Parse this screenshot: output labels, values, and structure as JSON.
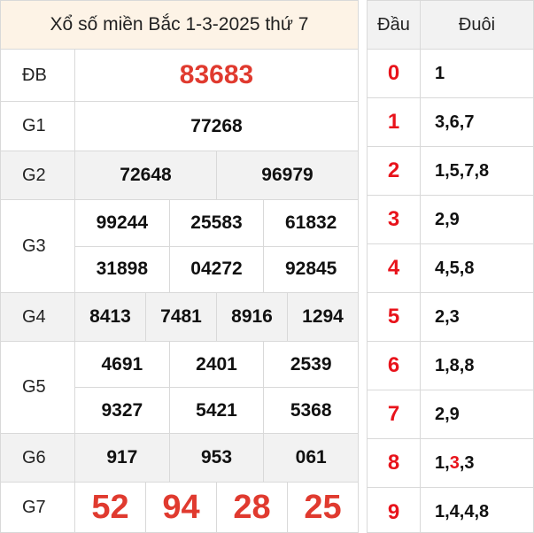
{
  "title": "Xổ số miền Bắc 1-3-2025 thứ 7",
  "prizes": [
    {
      "label": "ĐB",
      "lines": [
        [
          "83683"
        ]
      ]
    },
    {
      "label": "G1",
      "lines": [
        [
          "77268"
        ]
      ]
    },
    {
      "label": "G2",
      "lines": [
        [
          "72648",
          "96979"
        ]
      ]
    },
    {
      "label": "G3",
      "lines": [
        [
          "99244",
          "25583",
          "61832"
        ],
        [
          "31898",
          "04272",
          "92845"
        ]
      ]
    },
    {
      "label": "G4",
      "lines": [
        [
          "8413",
          "7481",
          "8916",
          "1294"
        ]
      ]
    },
    {
      "label": "G5",
      "lines": [
        [
          "4691",
          "2401",
          "2539"
        ],
        [
          "9327",
          "5421",
          "5368"
        ]
      ]
    },
    {
      "label": "G6",
      "lines": [
        [
          "917",
          "953",
          "061"
        ]
      ]
    },
    {
      "label": "G7",
      "lines": [
        [
          "52",
          "94",
          "28",
          "25"
        ]
      ]
    }
  ],
  "loto": {
    "header_dau": "Đầu",
    "header_duoi": "Đuôi",
    "rows": [
      {
        "dau": "0",
        "duoi": "1"
      },
      {
        "dau": "1",
        "duoi": "3,6,7"
      },
      {
        "dau": "2",
        "duoi": "1,5,7,8"
      },
      {
        "dau": "3",
        "duoi": "2,9"
      },
      {
        "dau": "4",
        "duoi": "4,5,8"
      },
      {
        "dau": "5",
        "duoi": "2,3"
      },
      {
        "dau": "6",
        "duoi": "1,8,8"
      },
      {
        "dau": "7",
        "duoi": "2,9"
      },
      {
        "dau": "8",
        "duoi_parts": [
          "1,",
          "3",
          ",3"
        ]
      },
      {
        "dau": "9",
        "duoi": "1,4,4,8"
      }
    ]
  },
  "colors": {
    "accent_red": "#e03a2f",
    "loto_red": "#e8131b",
    "title_bg": "#fdf3e6",
    "shade": "#f2f2f2"
  }
}
